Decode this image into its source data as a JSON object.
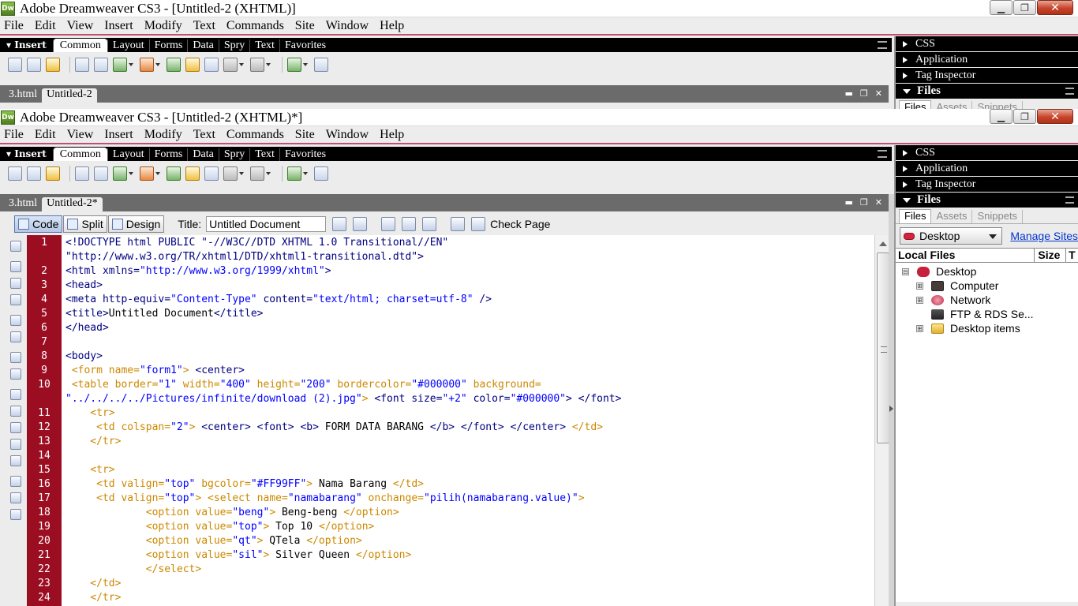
{
  "app": {
    "title_back": "Adobe Dreamweaver CS3 - [Untitled-2 (XHTML)]",
    "title_front": "Adobe Dreamweaver CS3 - [Untitled-2 (XHTML)*]",
    "logo": "Dw"
  },
  "menu": [
    "File",
    "Edit",
    "View",
    "Insert",
    "Modify",
    "Text",
    "Commands",
    "Site",
    "Window",
    "Help"
  ],
  "insert": {
    "label": "Insert",
    "tabs": [
      "Common",
      "Layout",
      "Forms",
      "Data",
      "Spry",
      "Text",
      "Favorites"
    ]
  },
  "panels": {
    "collapsed": [
      "CSS",
      "Application",
      "Tag Inspector"
    ],
    "files": {
      "header": "Files",
      "tabs": [
        "Files",
        "Assets",
        "Snippets"
      ],
      "site_select": "Desktop",
      "manage_link": "Manage Sites",
      "columns": [
        "Local Files",
        "Size",
        "T"
      ],
      "tree": [
        {
          "label": "Desktop",
          "level": 0,
          "expander": "⊟",
          "icon": "desktop-icon"
        },
        {
          "label": "Computer",
          "level": 1,
          "expander": "⊞",
          "icon": "computer-icon"
        },
        {
          "label": "Network",
          "level": 1,
          "expander": "⊞",
          "icon": "network-icon"
        },
        {
          "label": "FTP & RDS Se...",
          "level": 1,
          "expander": "",
          "icon": "ftp-icon"
        },
        {
          "label": "Desktop items",
          "level": 1,
          "expander": "⊞",
          "icon": "folder-icon"
        }
      ]
    }
  },
  "docs": {
    "tabs_back": [
      "3.html",
      "Untitled-2"
    ],
    "tabs_front": [
      "3.html",
      "Untitled-2*"
    ]
  },
  "doc_toolbar": {
    "code": "Code",
    "split": "Split",
    "design": "Design",
    "title_label": "Title:",
    "title_value": "Untitled Document",
    "check_page": "Check Page"
  },
  "code_lines": [
    {
      "n": "1",
      "spans": [
        [
          "t-tag",
          "<!DOCTYPE html PUBLIC \"-//W3C//DTD XHTML 1.0 Transitional//EN\""
        ]
      ]
    },
    {
      "n": "",
      "spans": [
        [
          "t-tag",
          "\"http://www.w3.org/TR/xhtml1/DTD/xhtml1-transitional.dtd\">"
        ]
      ]
    },
    {
      "n": "2",
      "spans": [
        [
          "t-tag",
          "<html "
        ],
        [
          "t-attr",
          "xmlns="
        ],
        [
          "t-val",
          "\"http://www.w3.org/1999/xhtml\""
        ],
        [
          "t-tag",
          ">"
        ]
      ]
    },
    {
      "n": "3",
      "spans": [
        [
          "t-tag",
          "<head>"
        ]
      ]
    },
    {
      "n": "4",
      "spans": [
        [
          "t-tag",
          "<meta "
        ],
        [
          "t-attr",
          "http-equiv="
        ],
        [
          "t-val",
          "\"Content-Type\""
        ],
        [
          "t-attr",
          " content="
        ],
        [
          "t-val",
          "\"text/html; charset=utf-8\""
        ],
        [
          "t-tag",
          " />"
        ]
      ]
    },
    {
      "n": "5",
      "spans": [
        [
          "t-tag",
          "<title>"
        ],
        [
          "t-txt",
          "Untitled Document"
        ],
        [
          "t-tag",
          "</title>"
        ]
      ]
    },
    {
      "n": "6",
      "spans": [
        [
          "t-tag",
          "</head>"
        ]
      ]
    },
    {
      "n": "7",
      "spans": [
        [
          "t-txt",
          ""
        ]
      ]
    },
    {
      "n": "8",
      "spans": [
        [
          "t-tag",
          "<body>"
        ]
      ]
    },
    {
      "n": "9",
      "spans": [
        [
          "t-org",
          " <form "
        ],
        [
          "t-org",
          "name="
        ],
        [
          "t-val",
          "\"form1\""
        ],
        [
          "t-org",
          ">"
        ],
        [
          "t-tag",
          " <center>"
        ]
      ]
    },
    {
      "n": "10",
      "spans": [
        [
          "t-org",
          " <table "
        ],
        [
          "t-org",
          "border="
        ],
        [
          "t-val",
          "\"1\""
        ],
        [
          "t-org",
          " width="
        ],
        [
          "t-val",
          "\"400\""
        ],
        [
          "t-org",
          " height="
        ],
        [
          "t-val",
          "\"200\""
        ],
        [
          "t-org",
          " bordercolor="
        ],
        [
          "t-val",
          "\"#000000\""
        ],
        [
          "t-org",
          " background="
        ]
      ]
    },
    {
      "n": "",
      "spans": [
        [
          "t-val",
          "\"../../../../Pictures/infinite/download (2).jpg\""
        ],
        [
          "t-org",
          ">"
        ],
        [
          "t-tag",
          " <font "
        ],
        [
          "t-attr",
          "size="
        ],
        [
          "t-val",
          "\"+2\""
        ],
        [
          "t-attr",
          " color="
        ],
        [
          "t-val",
          "\"#000000\""
        ],
        [
          "t-tag",
          "> </font>"
        ]
      ]
    },
    {
      "n": "11",
      "spans": [
        [
          "t-org",
          "    <tr>"
        ]
      ]
    },
    {
      "n": "12",
      "spans": [
        [
          "t-org",
          "     <td "
        ],
        [
          "t-org",
          "colspan="
        ],
        [
          "t-val",
          "\"2\""
        ],
        [
          "t-org",
          ">"
        ],
        [
          "t-tag",
          " <center> <font> <b> "
        ],
        [
          "t-txt",
          "FORM DATA BARANG "
        ],
        [
          "t-tag",
          "</b> </font> </center> "
        ],
        [
          "t-org",
          "</td>"
        ]
      ]
    },
    {
      "n": "13",
      "spans": [
        [
          "t-org",
          "    </tr>"
        ]
      ]
    },
    {
      "n": "14",
      "spans": [
        [
          "t-txt",
          ""
        ]
      ]
    },
    {
      "n": "15",
      "spans": [
        [
          "t-org",
          "    <tr>"
        ]
      ]
    },
    {
      "n": "16",
      "spans": [
        [
          "t-org",
          "     <td "
        ],
        [
          "t-org",
          "valign="
        ],
        [
          "t-val",
          "\"top\""
        ],
        [
          "t-org",
          " bgcolor="
        ],
        [
          "t-val",
          "\"#FF99FF\""
        ],
        [
          "t-org",
          ">"
        ],
        [
          "t-txt",
          " Nama Barang "
        ],
        [
          "t-org",
          "</td>"
        ]
      ]
    },
    {
      "n": "17",
      "spans": [
        [
          "t-org",
          "     <td "
        ],
        [
          "t-org",
          "valign="
        ],
        [
          "t-val",
          "\"top\""
        ],
        [
          "t-org",
          ">"
        ],
        [
          "t-org",
          " <select "
        ],
        [
          "t-org",
          "name="
        ],
        [
          "t-val",
          "\"namabarang\""
        ],
        [
          "t-org",
          " onchange="
        ],
        [
          "t-val",
          "\"pilih(namabarang.value)\""
        ],
        [
          "t-org",
          ">"
        ]
      ]
    },
    {
      "n": "18",
      "spans": [
        [
          "t-org",
          "             <option "
        ],
        [
          "t-org",
          "value="
        ],
        [
          "t-val",
          "\"beng\""
        ],
        [
          "t-org",
          ">"
        ],
        [
          "t-txt",
          " Beng-beng "
        ],
        [
          "t-org",
          "</option>"
        ]
      ]
    },
    {
      "n": "19",
      "spans": [
        [
          "t-org",
          "             <option "
        ],
        [
          "t-org",
          "value="
        ],
        [
          "t-val",
          "\"top\""
        ],
        [
          "t-org",
          ">"
        ],
        [
          "t-txt",
          " Top 10 "
        ],
        [
          "t-org",
          "</option>"
        ]
      ]
    },
    {
      "n": "20",
      "spans": [
        [
          "t-org",
          "             <option "
        ],
        [
          "t-org",
          "value="
        ],
        [
          "t-val",
          "\"qt\""
        ],
        [
          "t-org",
          ">"
        ],
        [
          "t-txt",
          " QTela "
        ],
        [
          "t-org",
          "</option>"
        ]
      ]
    },
    {
      "n": "21",
      "spans": [
        [
          "t-org",
          "             <option "
        ],
        [
          "t-org",
          "value="
        ],
        [
          "t-val",
          "\"sil\""
        ],
        [
          "t-org",
          ">"
        ],
        [
          "t-txt",
          " Silver Queen "
        ],
        [
          "t-org",
          "</option>"
        ]
      ]
    },
    {
      "n": "22",
      "spans": [
        [
          "t-org",
          "             </select>"
        ]
      ]
    },
    {
      "n": "23",
      "spans": [
        [
          "t-org",
          "    </td>"
        ]
      ]
    },
    {
      "n": "24",
      "spans": [
        [
          "t-org",
          "    </tr>"
        ]
      ]
    }
  ]
}
